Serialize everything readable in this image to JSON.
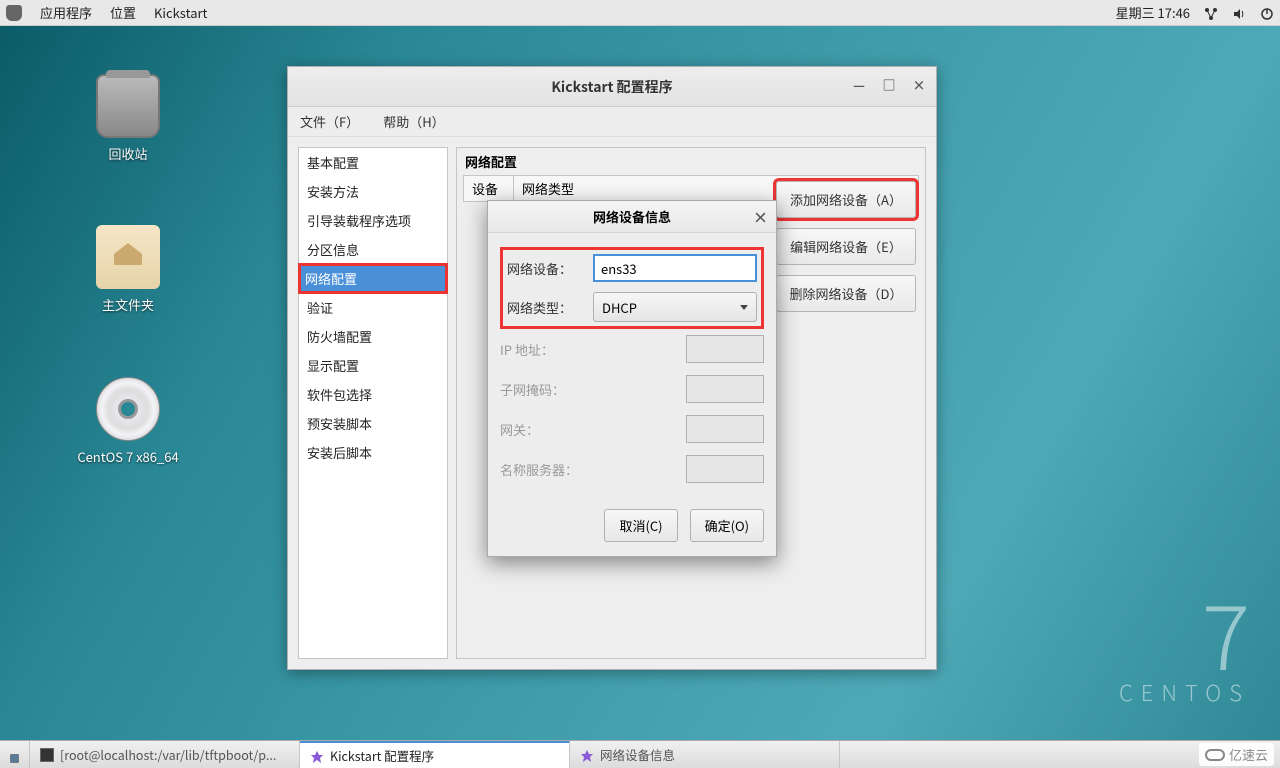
{
  "panel": {
    "apps": "应用程序",
    "places": "位置",
    "kickstart": "Kickstart",
    "date": "星期三 17:46"
  },
  "desktop": {
    "trash": "回收站",
    "home": "主文件夹",
    "cd": "CentOS 7 x86_64"
  },
  "centos": {
    "seven": "7",
    "word": "CENTOS"
  },
  "window": {
    "title": "Kickstart 配置程序",
    "menu_file": "文件（F）",
    "menu_help": "帮助（H）",
    "section_title": "网络配置",
    "table": {
      "col1": "设备",
      "col2": "网络类型"
    },
    "actions": {
      "add": "添加网络设备（A）",
      "edit": "编辑网络设备（E）",
      "delete": "删除网络设备（D）"
    }
  },
  "sidebar": {
    "items": [
      "基本配置",
      "安装方法",
      "引导装载程序选项",
      "分区信息",
      "网络配置",
      "验证",
      "防火墙配置",
      "显示配置",
      "软件包选择",
      "预安装脚本",
      "安装后脚本"
    ],
    "selected_index": 4
  },
  "dialog": {
    "title": "网络设备信息",
    "labels": {
      "device": "网络设备：",
      "type": "网络类型：",
      "ip": "IP 地址：",
      "mask": "子网掩码：",
      "gateway": "网关：",
      "dns": "名称服务器："
    },
    "values": {
      "device": "ens33",
      "type": "DHCP",
      "ip": "",
      "mask": "",
      "gateway": "",
      "dns": ""
    },
    "buttons": {
      "cancel": "取消(C)",
      "ok": "确定(O)"
    }
  },
  "taskbar": {
    "terminal": "[root@localhost:/var/lib/tftpboot/p...",
    "kickstart": "Kickstart 配置程序",
    "dialog": "网络设备信息"
  },
  "watermark": "亿速云"
}
